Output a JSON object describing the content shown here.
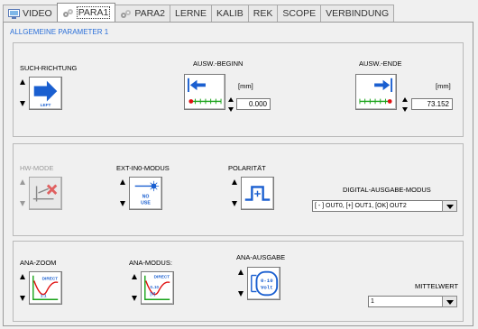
{
  "tabs": [
    {
      "label": "VIDEO",
      "icon": "monitor-icon",
      "active": false
    },
    {
      "label": "PARA1",
      "icon": "gear-icon",
      "active": true
    },
    {
      "label": "PARA2",
      "icon": "gear-icon",
      "active": false
    },
    {
      "label": "LERNE",
      "active": false
    },
    {
      "label": "KALIB",
      "active": false
    },
    {
      "label": "REK",
      "active": false
    },
    {
      "label": "SCOPE",
      "active": false
    },
    {
      "label": "VERBINDUNG",
      "active": false
    }
  ],
  "section_title": "ALLGEMEINE PARAMETER 1",
  "group1": {
    "such_richtung": {
      "label": "SUCH-RICHTUNG",
      "value": "LEFT",
      "icon": "arrow-right-icon"
    },
    "ausw_beginn": {
      "label": "AUSW.-BEGINN",
      "unit": "[mm]",
      "value": "0.000",
      "icon": "start-marker-icon"
    },
    "ausw_ende": {
      "label": "AUSW.-ENDE",
      "unit": "[mm]",
      "value": "73.152",
      "icon": "end-marker-icon"
    }
  },
  "group2": {
    "hw_mode": {
      "label": "HW-MODE",
      "icon": "disabled-hw-icon"
    },
    "ext_in0": {
      "label": "EXT-IN0-MODUS",
      "value_line1": "NO",
      "value_line2": "USE",
      "icon": "laser-icon"
    },
    "polaritaet": {
      "label": "POLARITÄT",
      "icon": "pulse-positive-icon"
    },
    "digital": {
      "label": "DIGITAL-AUSGABE-MODUS",
      "value": "[ - ] OUT0, [+] OUT1, [OK] OUT2"
    }
  },
  "group3": {
    "ana_zoom": {
      "label": "ANA-ZOOM",
      "tag": "DIRECT",
      "ratio": "1:1",
      "icon": "zoom-curve-icon"
    },
    "ana_modus": {
      "label": "ANA-MODUS:",
      "tag": "DIRECT",
      "range": "0..10",
      "unit": "[V]",
      "icon": "mode-curve-icon"
    },
    "ana_ausgabe": {
      "label": "ANA-AUSGABE",
      "line1": "0-10",
      "line2": "Volt",
      "icon": "analog-output-icon"
    },
    "mittelwert": {
      "label": "MITTELWERT",
      "value": "1"
    }
  },
  "colors": {
    "accent_blue": "#1a5fd0",
    "title_blue": "#2a6fd8",
    "marker_green": "#1aa31a",
    "marker_red": "#e01010"
  }
}
